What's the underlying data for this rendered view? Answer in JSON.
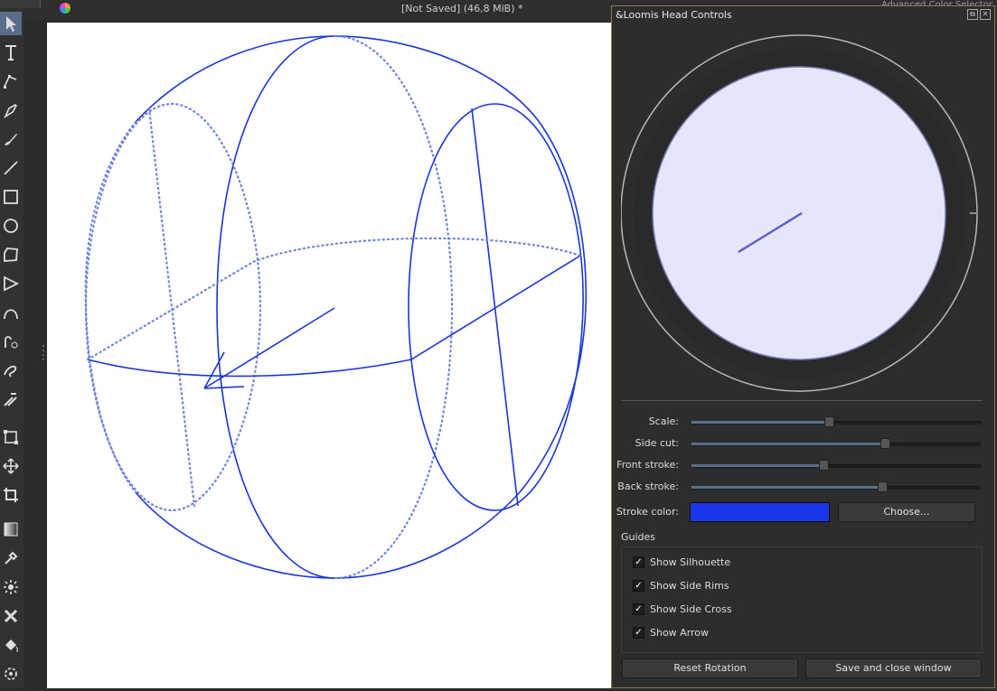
{
  "window": {
    "title": "[Not Saved]  (46,8 MiB) *",
    "right_panel_peek": "Advanced Color Selector"
  },
  "toolbox": {
    "tools": [
      {
        "icon": "select-pointer-icon",
        "selected": true
      },
      {
        "icon": "text-tool-icon"
      },
      {
        "icon": "edit-shapes-icon"
      },
      {
        "icon": "calligraphy-pen-icon"
      },
      {
        "icon": "brush-icon"
      },
      {
        "icon": "line-tool-icon"
      },
      {
        "icon": "rectangle-tool-icon"
      },
      {
        "icon": "ellipse-tool-icon"
      },
      {
        "icon": "polygon-tool-icon"
      },
      {
        "icon": "polyline-tool-icon"
      },
      {
        "icon": "bezier-curve-icon"
      },
      {
        "icon": "dynamic-brush-icon"
      },
      {
        "icon": "freehand-path-icon"
      },
      {
        "icon": "multibrush-icon"
      },
      {
        "icon": "transform-tool-icon"
      },
      {
        "icon": "move-tool-icon"
      },
      {
        "icon": "crop-tool-icon"
      },
      {
        "icon": "gradient-tool-icon"
      },
      {
        "icon": "color-picker-icon"
      },
      {
        "icon": "smart-patch-icon"
      },
      {
        "icon": "assistant-tool-icon"
      },
      {
        "icon": "fill-tool-icon"
      },
      {
        "icon": "contiguous-select-icon"
      }
    ]
  },
  "canvas": {
    "stroke_color": "#1a36d8",
    "dotted_color": "#6f82e0",
    "background": "#ffffff"
  },
  "dialog": {
    "title": "&Loomis Head Controls",
    "dial": {
      "face_color": "#e6e6fb",
      "pointer_color": "#6464c8"
    },
    "sliders": [
      {
        "label": "Scale:",
        "value": 0.474
      },
      {
        "label": "Side cut:",
        "value": 0.67
      },
      {
        "label": "Front stroke:",
        "value": 0.455
      },
      {
        "label": "Back stroke:",
        "value": 0.66
      }
    ],
    "stroke_color_label": "Stroke color:",
    "stroke_color_value": "#1a36e8",
    "choose_button": "Choose...",
    "guides_title": "Guides",
    "guides": [
      {
        "label": "Show Silhouette",
        "checked": true
      },
      {
        "label": "Show Side Rims",
        "checked": true
      },
      {
        "label": "Show Side Cross",
        "checked": true
      },
      {
        "label": "Show Arrow",
        "checked": true
      }
    ],
    "reset_button": "Reset Rotation",
    "save_close_button": "Save and close window",
    "dock_buttons": [
      "float",
      "close"
    ]
  }
}
